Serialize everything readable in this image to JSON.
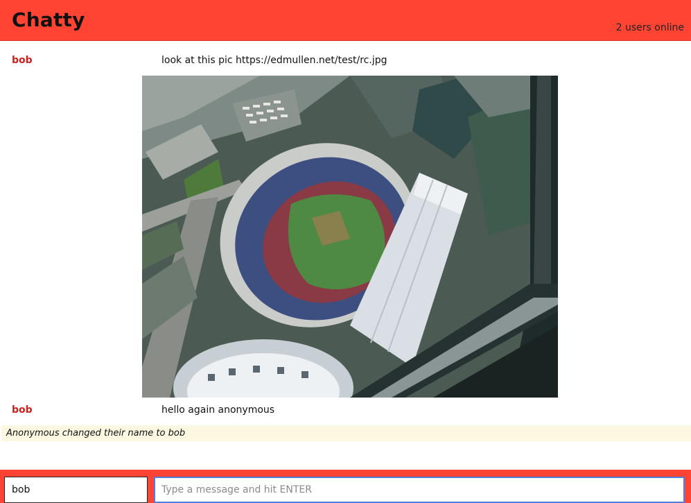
{
  "header": {
    "title": "Chatty",
    "online_status": "2 users online"
  },
  "messages": [
    {
      "user": "bob",
      "text": "look at this pic https://edmullen.net/test/rc.jpg",
      "has_image": true,
      "image_icon": "aerial-stadium-photo"
    },
    {
      "user": "bob",
      "text": "hello again anonymous"
    }
  ],
  "system_messages": [
    {
      "text": "Anonymous changed their name to bob"
    }
  ],
  "composer": {
    "name_value": "bob",
    "message_placeholder": "Type a message and hit ENTER",
    "message_value": ""
  },
  "colors": {
    "accent": "#ff4433",
    "username": "#cc1f1f",
    "system_bg": "#fbf7e1",
    "input_focus": "#4f7fd9"
  }
}
